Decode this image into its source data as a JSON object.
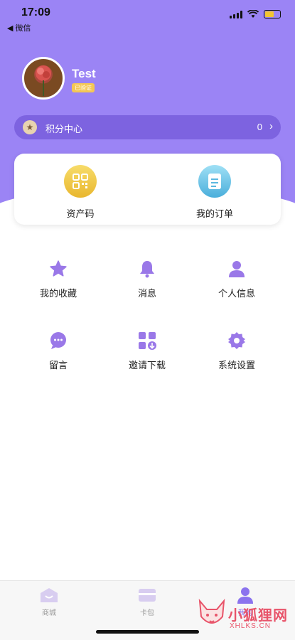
{
  "status_bar": {
    "time": "17:09",
    "back_app": "◀ 微信"
  },
  "profile": {
    "name": "Test",
    "badge": "已验证"
  },
  "points": {
    "label": "积分中心",
    "value": "0",
    "chevron": "›"
  },
  "card": [
    {
      "label": "资产码",
      "icon": "qrcode-icon"
    },
    {
      "label": "我的订单",
      "icon": "order-icon"
    }
  ],
  "menu": [
    {
      "label": "我的收藏",
      "icon": "star-icon"
    },
    {
      "label": "消息",
      "icon": "bell-icon"
    },
    {
      "label": "个人信息",
      "icon": "person-icon"
    },
    {
      "label": "留言",
      "icon": "chat-bubble-icon"
    },
    {
      "label": "邀请下载",
      "icon": "invite-download-icon"
    },
    {
      "label": "系统设置",
      "icon": "gear-icon"
    }
  ],
  "tabs": [
    {
      "label": "商城",
      "icon": "shop-icon",
      "active": false
    },
    {
      "label": "卡包",
      "icon": "card-wallet-icon",
      "active": false
    },
    {
      "label": "我的",
      "icon": "profile-icon",
      "active": true
    }
  ],
  "watermark": {
    "title": "小狐狸网",
    "url": "XHLKS.CN"
  },
  "colors": {
    "accent": "#9b84f5",
    "points_bar": "#7d63e0",
    "menu_icon": "#9a78e8",
    "badge": "#f4c754"
  }
}
